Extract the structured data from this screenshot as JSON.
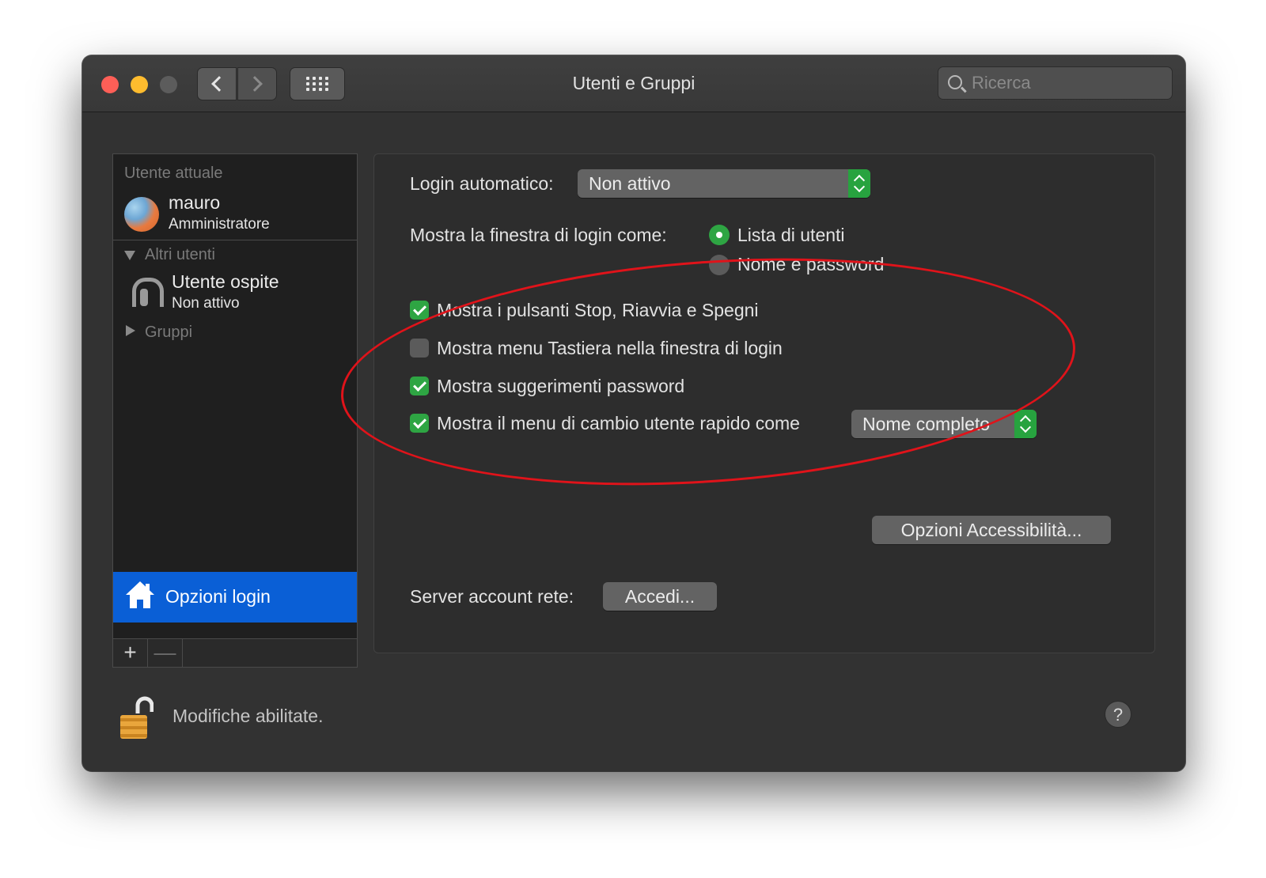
{
  "window": {
    "title": "Utenti e Gruppi",
    "search_placeholder": "Ricerca"
  },
  "sidebar": {
    "current_user_heading": "Utente attuale",
    "current_user": {
      "name": "mauro",
      "role": "Amministratore"
    },
    "other_users_heading": "Altri utenti",
    "other_users": [
      {
        "name": "Utente ospite",
        "status": "Non attivo"
      }
    ],
    "groups_heading": "Gruppi",
    "login_options_label": "Opzioni login",
    "add_label": "+",
    "remove_label": "—"
  },
  "login": {
    "auto_login_label": "Login automatico:",
    "auto_login_value": "Non attivo",
    "show_window_label": "Mostra la finestra di login come:",
    "radio_options": [
      {
        "label": "Lista di utenti",
        "selected": true
      },
      {
        "label": "Nome e password",
        "selected": false
      }
    ],
    "checkboxes": [
      {
        "label": "Mostra i pulsanti Stop, Riavvia e Spegni",
        "checked": true
      },
      {
        "label": "Mostra menu Tastiera nella finestra di login",
        "checked": false
      },
      {
        "label": "Mostra suggerimenti password",
        "checked": true
      },
      {
        "label": "Mostra il menu di cambio utente rapido come",
        "checked": true
      }
    ],
    "fast_switch_value": "Nome completo",
    "accessibility_button": "Opzioni Accessibilità...",
    "network_server_label": "Server account rete:",
    "join_button": "Accedi..."
  },
  "footer": {
    "lock_status": "Modifiche abilitate.",
    "help_label": "?"
  },
  "colors": {
    "accent_green": "#2ea543",
    "selection_blue": "#0a5fd6",
    "annotation_red": "#e0131a"
  }
}
